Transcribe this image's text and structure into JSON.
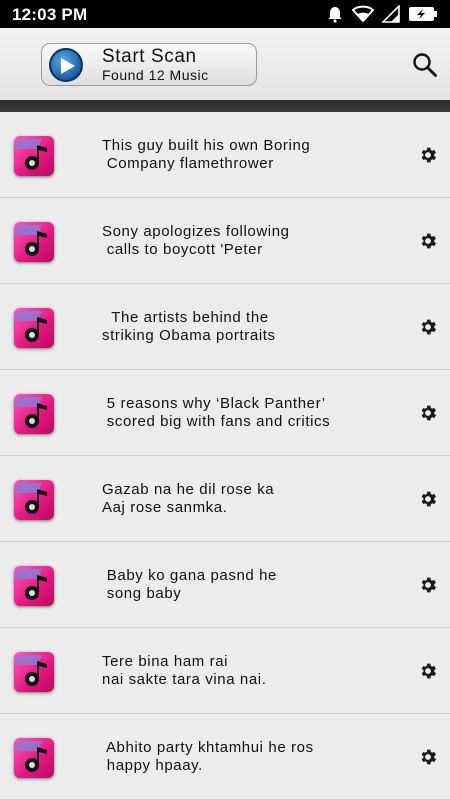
{
  "status_bar": {
    "time": "12:03 PM"
  },
  "header": {
    "scan_title": "Start Scan",
    "scan_subtitle": "Found 12 Music"
  },
  "songs": [
    {
      "line1": "This guy built his own Boring",
      "line2": " Company flamethrower"
    },
    {
      "line1": "Sony apologizes following",
      "line2": " calls to boycott 'Peter"
    },
    {
      "line1": "  The artists behind the",
      "line2": "striking Obama portraits"
    },
    {
      "line1": " 5 reasons why ‘Black Panther’",
      "line2": " scored big with fans and critics"
    },
    {
      "line1": "Gazab na he dil rose ka",
      "line2": "Aaj rose sanmka."
    },
    {
      "line1": " Baby ko gana pasnd he",
      "line2": " song baby"
    },
    {
      "line1": "Tere bina ham rai",
      "line2": "nai sakte tara vina nai."
    },
    {
      "line1": " Abhito party khtamhui he ros",
      "line2": " happy hpaay."
    }
  ],
  "icons": {
    "scan": "play-icon",
    "search": "search-icon",
    "settings": "gear-icon",
    "thumbnail": "music-note-icon"
  },
  "colors": {
    "thumbnail": "#e0167f",
    "scan_button": "#1d5ea3"
  }
}
